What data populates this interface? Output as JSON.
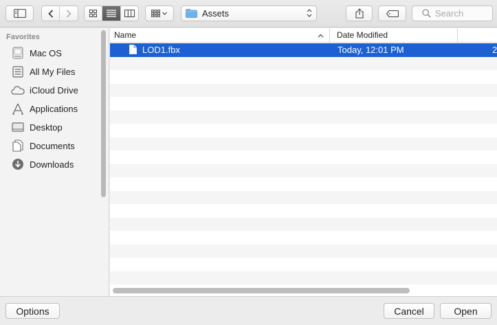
{
  "toolbar": {
    "path_folder": "Assets",
    "search_placeholder": "Search"
  },
  "sidebar": {
    "heading": "Favorites",
    "items": [
      {
        "label": "Mac OS",
        "icon": "hard-drive-icon"
      },
      {
        "label": "All My Files",
        "icon": "all-files-icon"
      },
      {
        "label": "iCloud Drive",
        "icon": "cloud-icon"
      },
      {
        "label": "Applications",
        "icon": "applications-icon"
      },
      {
        "label": "Desktop",
        "icon": "desktop-icon"
      },
      {
        "label": "Documents",
        "icon": "documents-icon"
      },
      {
        "label": "Downloads",
        "icon": "downloads-icon"
      }
    ]
  },
  "list": {
    "columns": {
      "name": "Name",
      "date": "Date Modified"
    },
    "files": [
      {
        "name": "LOD1.fbx",
        "date": "Today, 12:01 PM",
        "extra": "2",
        "selected": true
      }
    ]
  },
  "footer": {
    "options_label": "Options",
    "cancel_label": "Cancel",
    "open_label": "Open"
  },
  "colors": {
    "selection": "#1c60d3",
    "folder": "#6fb2e8"
  }
}
